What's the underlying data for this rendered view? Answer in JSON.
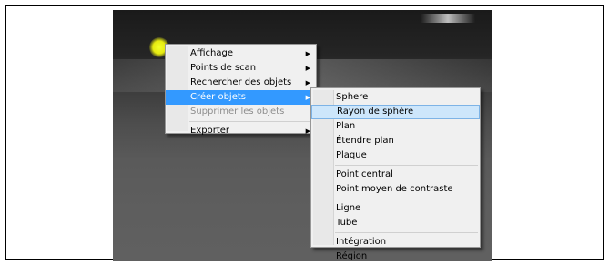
{
  "context_menu": {
    "items": [
      {
        "label": "Affichage",
        "submenu": true
      },
      {
        "label": "Points de scan",
        "submenu": true
      },
      {
        "label": "Rechercher des objets",
        "submenu": true
      },
      {
        "label": "Créer objets",
        "submenu": true,
        "highlighted": true
      },
      {
        "label": "Supprimer les objets",
        "disabled": true
      },
      {
        "label": "Exporter",
        "submenu": true
      }
    ]
  },
  "submenu": {
    "items": [
      {
        "label": "Sphere"
      },
      {
        "label": "Rayon de sphère",
        "highlighted": true
      },
      {
        "label": "Plan"
      },
      {
        "label": "Étendre plan"
      },
      {
        "label": "Plaque"
      },
      {
        "label": "Point central"
      },
      {
        "label": "Point moyen de contraste"
      },
      {
        "label": "Ligne"
      },
      {
        "label": "Tube"
      },
      {
        "label": "Intégration"
      },
      {
        "label": "Région"
      }
    ]
  },
  "colors": {
    "highlight": "#3399ff",
    "hover": "#cde6fb",
    "menu_bg": "#f0f0f0",
    "disabled": "#8e8e8e"
  },
  "icons": {
    "submenu_arrow": "▶"
  }
}
